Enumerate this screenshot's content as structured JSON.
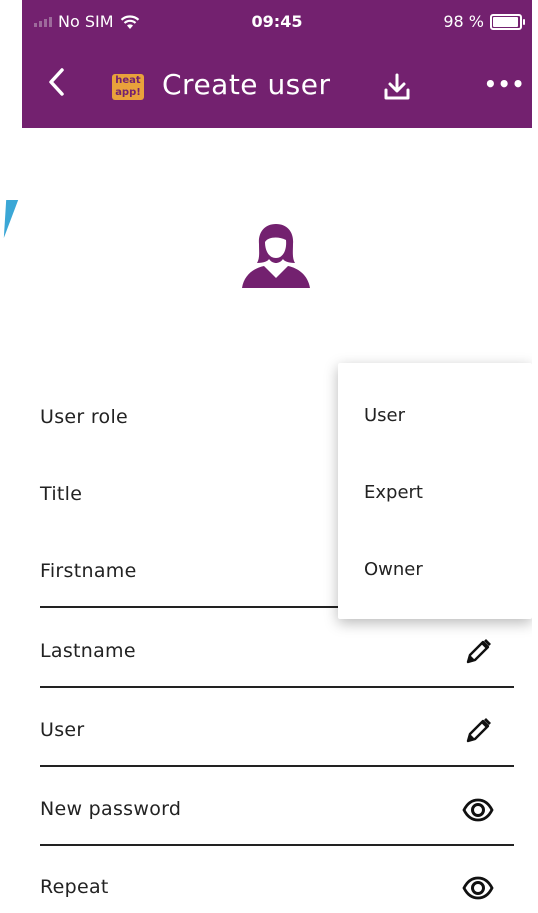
{
  "statusbar": {
    "carrier": "No SIM",
    "time": "09:45",
    "battery": "98 %",
    "battery_level": 0.98
  },
  "toolbar": {
    "title": "Create user",
    "logo_text_top": "heat",
    "logo_text_bottom": "app!",
    "back_icon": "chevron-left-icon",
    "download_icon": "download-icon",
    "more_label": "•••"
  },
  "form": {
    "user_role_label": "User role",
    "title_label": "Title",
    "firstname_label": "Firstname",
    "lastname_label": "Lastname",
    "user_label": "User",
    "new_password_label": "New password",
    "repeat_label": "Repeat"
  },
  "dropdown": {
    "options": [
      "User",
      "Expert",
      "Owner"
    ]
  },
  "colors": {
    "brand": "#73216f",
    "logo_bg": "#e9a13b",
    "accent": "#3ba7d6"
  }
}
